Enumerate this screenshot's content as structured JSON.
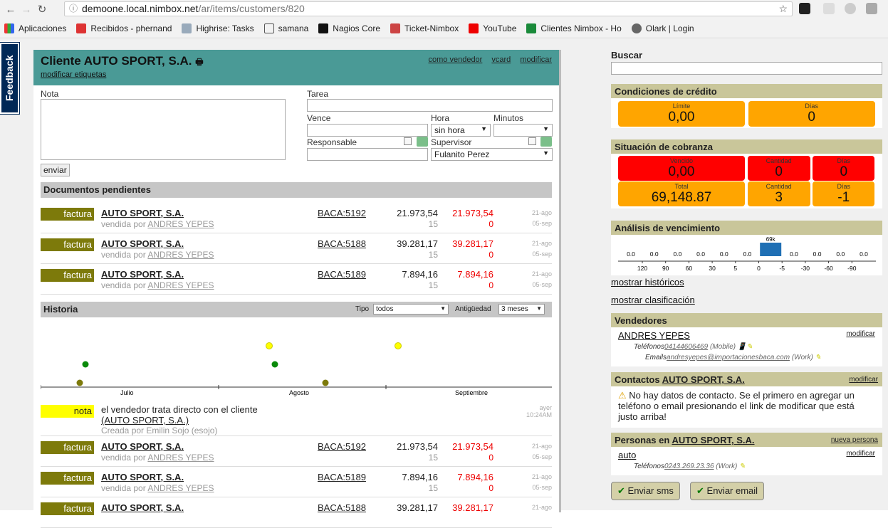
{
  "browser": {
    "url_host": "demoone.local.nimbox.net",
    "url_path": "/ar/items/customers/820",
    "bookmarks": [
      "Aplicaciones",
      "Recibidos - phernand",
      "Highrise: Tasks",
      "samana",
      "Nagios Core",
      "Ticket-Nimbox",
      "YouTube",
      "Clientes Nimbox - Ho",
      "Olark | Login"
    ]
  },
  "feedback": "Feedback",
  "header": {
    "title": "Cliente AUTO SPORT, S.A.",
    "sub": "modificar etiquetas",
    "link1": "como vendedor",
    "link2": "vcard",
    "link3": "modificar"
  },
  "form": {
    "nota": "Nota",
    "tarea": "Tarea",
    "vence": "Vence",
    "hora": "Hora",
    "minutos": "Minutos",
    "hora_val": "sin hora",
    "responsable": "Responsable",
    "supervisor": "Supervisor",
    "supervisor_val": "Fulanito Perez",
    "enviar": "enviar"
  },
  "docs": {
    "title": "Documentos pendientes",
    "rows": [
      {
        "tag": "factura",
        "name": "AUTO SPORT, S.A.",
        "seller_pre": "vendida por ",
        "seller": "ANDRES YEPES",
        "doc": "BACA:5192",
        "amt": "21.973,54",
        "days": "15",
        "red": "21.973,54",
        "zero": "0",
        "d1": "21-ago",
        "d2": "05-sep"
      },
      {
        "tag": "factura",
        "name": "AUTO SPORT, S.A.",
        "seller_pre": "vendida por ",
        "seller": "ANDRES YEPES",
        "doc": "BACA:5188",
        "amt": "39.281,17",
        "days": "15",
        "red": "39.281,17",
        "zero": "0",
        "d1": "21-ago",
        "d2": "05-sep"
      },
      {
        "tag": "factura",
        "name": "AUTO SPORT, S.A.",
        "seller_pre": "vendida por ",
        "seller": "ANDRES YEPES",
        "doc": "BACA:5189",
        "amt": "7.894,16",
        "days": "15",
        "red": "7.894,16",
        "zero": "0",
        "d1": "21-ago",
        "d2": "05-sep"
      }
    ]
  },
  "historia": {
    "title": "Historia",
    "tipo_label": "Tipo",
    "tipo_val": "todos",
    "ant_label": "Antigüedad",
    "ant_val": "3 meses",
    "months": [
      "Julio",
      "Agosto",
      "Septiembre"
    ]
  },
  "note": {
    "tag": "nota",
    "text": "el vendedor trata directo con el cliente",
    "link": "(AUTO SPORT, S.A.)",
    "by": "Creada por Emilin Sojo (esojo)",
    "d1": "ayer",
    "d2": "10:24AM"
  },
  "hist_rows": [
    {
      "tag": "factura",
      "name": "AUTO SPORT, S.A.",
      "seller_pre": "vendida por ",
      "seller": "ANDRES YEPES",
      "doc": "BACA:5192",
      "amt": "21.973,54",
      "days": "15",
      "red": "21.973,54",
      "zero": "0",
      "d1": "21-ago",
      "d2": "05-sep"
    },
    {
      "tag": "factura",
      "name": "AUTO SPORT, S.A.",
      "seller_pre": "vendida por ",
      "seller": "ANDRES YEPES",
      "doc": "BACA:5189",
      "amt": "7.894,16",
      "days": "15",
      "red": "7.894,16",
      "zero": "0",
      "d1": "21-ago",
      "d2": "05-sep"
    },
    {
      "tag": "factura",
      "name": "AUTO SPORT, S.A.",
      "seller_pre": "",
      "seller": "",
      "doc": "BACA:5188",
      "amt": "39.281,17",
      "days": "",
      "red": "39.281,17",
      "zero": "",
      "d1": "21-ago",
      "d2": ""
    }
  ],
  "side": {
    "buscar": "Buscar",
    "credito": {
      "title": "Condiciones de crédito",
      "l1": "Límite",
      "v1": "0,00",
      "l2": "Días",
      "v2": "0"
    },
    "cobranza": {
      "title": "Situación de cobranza",
      "vencido_l": "Vencido",
      "vencido_v": "0,00",
      "cant_l": "Cantidad",
      "cant_v": "0",
      "dias_l": "Días",
      "dias_v": "0",
      "total_l": "Total",
      "total_v": "69,148.87",
      "cant2_l": "Cantidad",
      "cant2_v": "3",
      "dias2_l": "Días",
      "dias2_v": "-1"
    },
    "analisis": {
      "title": "Análisis de vencimiento",
      "bar_label": "69k",
      "values": [
        "0.0",
        "0.0",
        "0.0",
        "0.0",
        "0.0",
        "0.0",
        "",
        "0.0",
        "0.0",
        "0.0",
        "0.0"
      ],
      "ticks": [
        "120",
        "90",
        "60",
        "30",
        "5",
        "0",
        "-5",
        "-30",
        "-60",
        "-90"
      ]
    },
    "historicos": "mostrar históricos",
    "clasificacion": "mostrar clasificación",
    "vendedores": {
      "title": "Vendedores",
      "name": "ANDRES YEPES",
      "mod": "modificar",
      "tel_l": "Teléfonos",
      "tel": "04144606469",
      "tel_t": "(Mobile)",
      "mail_l": "Emails",
      "mail": "andresyepes@importacionesbaca.com",
      "mail_t": "(Work)"
    },
    "contactos": {
      "title_pre": "Contactos ",
      "title_link": "AUTO SPORT, S.A.",
      "mod": "modificar",
      "text": "No hay datos de contacto. Se el primero en agregar un teléfono o email presionando el link de modificar que está justo arriba!"
    },
    "personas": {
      "title_pre": "Personas en ",
      "title_link": "AUTO SPORT, S.A.",
      "nueva": "nueva persona",
      "name": "auto",
      "mod": "modificar",
      "tel_l": "Teléfonos",
      "tel": "0243.269.23.36",
      "tel_t": "(Work)"
    },
    "sms": "Enviar sms",
    "email": "Enviar email"
  }
}
